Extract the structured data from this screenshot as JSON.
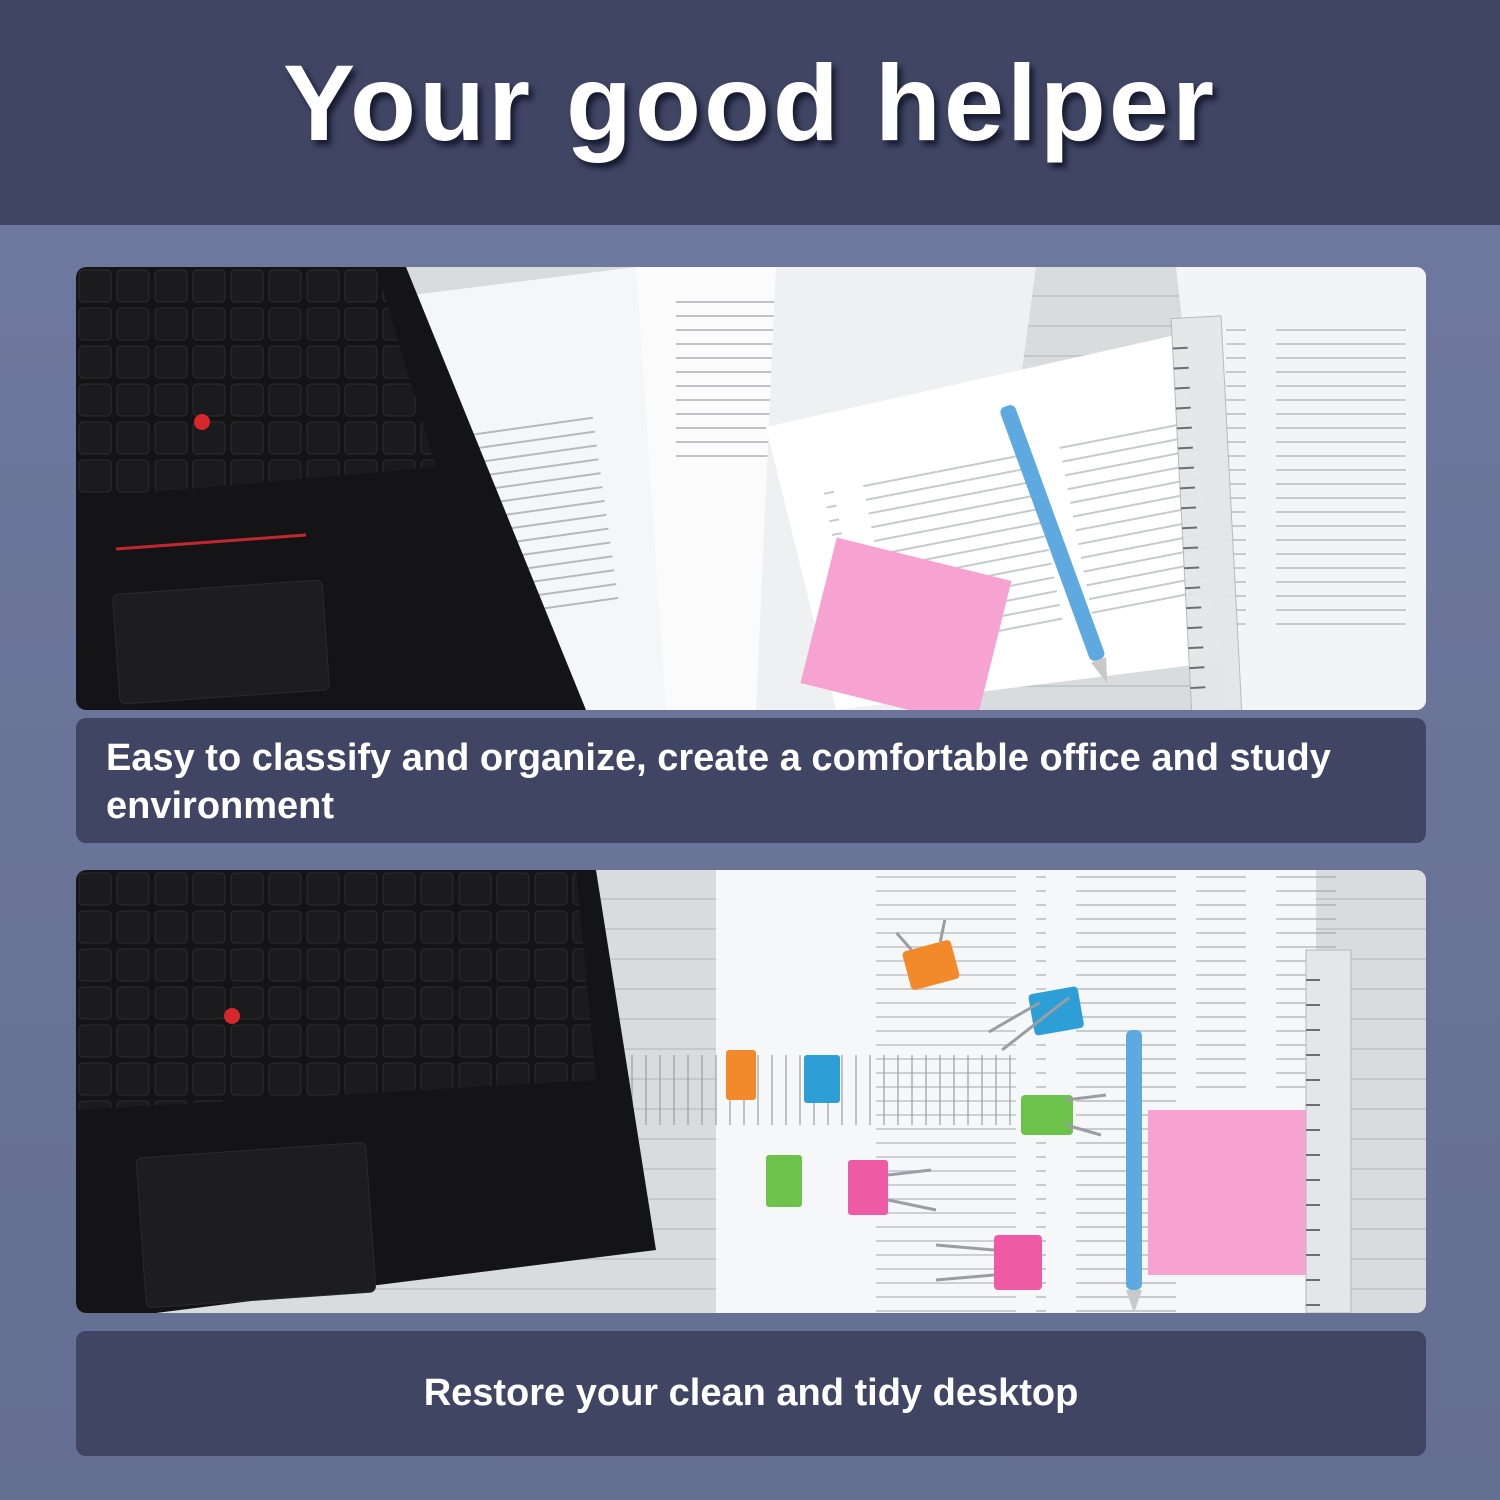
{
  "header": {
    "title": "Your good helper"
  },
  "section_1": {
    "image_alt": "Black laptop keyboard beside stacked paper declaration forms with a pink sticky note, blue pencil and ruler",
    "caption": "Easy to classify and organize, create a comfortable office and study environment"
  },
  "section_2": {
    "image_alt": "Black laptop keyboard beside paper documents held with colorful smiley binder clips, a blue pencil, pink sticky note and ruler",
    "caption": "Restore your clean and tidy desktop"
  },
  "colors": {
    "header_bg": "#3f4563",
    "page_bg": "#6a7398",
    "caption_bg": "#3f4563",
    "text": "#ffffff",
    "sticky_note": "#f7a3d2",
    "pencil": "#5ea9e0",
    "clip_orange": "#f28a2b",
    "clip_blue": "#2e9fd6",
    "clip_green": "#6cc24a",
    "clip_pink": "#ef5aa6"
  }
}
